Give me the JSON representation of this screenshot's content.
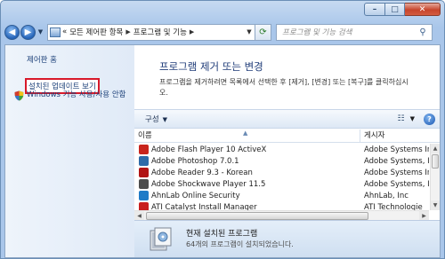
{
  "window": {
    "caption": {
      "minimize": "–",
      "maximize": "□",
      "close": "✕"
    }
  },
  "address_bar": {
    "breadcrumbs": [
      "«",
      "모든 제어판 항목",
      "프로그램 및 기능"
    ],
    "search_placeholder": "프로그램 및 기능 검색"
  },
  "sidebar": {
    "home": "제어판 홈",
    "installed_updates": "설치된 업데이트 보기",
    "windows_features": "Windows 기능 사용/사용 안함"
  },
  "main": {
    "title": "프로그램 제거 또는 변경",
    "description": "프로그램을 제거하려면 목록에서 선택한 후 [제거], [변경] 또는 [복구]를 클릭하십시오."
  },
  "toolbar": {
    "organize": "구성",
    "help": "?"
  },
  "list": {
    "columns": {
      "name": "이름",
      "publisher": "게시자"
    },
    "rows": [
      {
        "name": "Adobe Flash Player 10 ActiveX",
        "publisher": "Adobe Systems In",
        "icon": "flash-icon",
        "color": "#c8241c"
      },
      {
        "name": "Adobe Photoshop 7.0.1",
        "publisher": "Adobe Systems, Ir",
        "icon": "photoshop-icon",
        "color": "#2d6aa8"
      },
      {
        "name": "Adobe Reader 9.3 - Korean",
        "publisher": "Adobe Systems In",
        "icon": "reader-icon",
        "color": "#b11414"
      },
      {
        "name": "Adobe Shockwave Player 11.5",
        "publisher": "Adobe Systems, Ir",
        "icon": "shockwave-icon",
        "color": "#4d4d4d"
      },
      {
        "name": "AhnLab Online Security",
        "publisher": "AhnLab, Inc",
        "icon": "ahnlab-icon",
        "color": "#1f7bc7"
      },
      {
        "name": "ATI Catalyst Install Manager",
        "publisher": "ATI Technologie",
        "icon": "ati-icon",
        "color": "#c81e1e"
      }
    ]
  },
  "details": {
    "title": "현재 설치된 프로그램",
    "subtitle": "64개의 프로그램이 설치되었습니다."
  }
}
